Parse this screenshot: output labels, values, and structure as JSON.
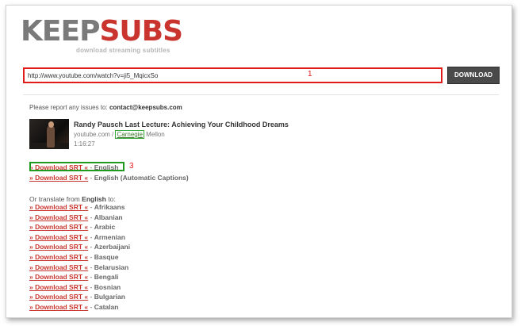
{
  "logo": {
    "keep": "KEEP",
    "subs": "SUBS",
    "tagline": "download streaming subtitles"
  },
  "search": {
    "url_value": "http://www.youtube.com/watch?v=ji5_MqicxSo",
    "download_label": "DOWNLOAD"
  },
  "annotations": {
    "one": "1",
    "three": "3"
  },
  "report": {
    "text": "Please report any issues to:",
    "email": "contact@keepsubs.com"
  },
  "video": {
    "title": "Randy Pausch Last Lecture: Achieving Your Childhood Dreams",
    "source_prefix": "youtube.com / ",
    "source_highlight": "Carnegie",
    "source_suffix": " Mellon",
    "duration": "1:16:27"
  },
  "downloads": [
    {
      "link": "» Download SRT «",
      "sep": " - ",
      "lang": "English"
    },
    {
      "link": "» Download SRT «",
      "sep": " - ",
      "lang": "English (Automatic Captions)"
    }
  ],
  "translate": {
    "prefix": "Or translate from",
    "lang": "English",
    "suffix": "to:"
  },
  "translations": [
    {
      "link": "» Download SRT «",
      "sep": " - ",
      "lang": "Afrikaans"
    },
    {
      "link": "» Download SRT «",
      "sep": " - ",
      "lang": "Albanian"
    },
    {
      "link": "» Download SRT «",
      "sep": " - ",
      "lang": "Arabic"
    },
    {
      "link": "» Download SRT «",
      "sep": " - ",
      "lang": "Armenian"
    },
    {
      "link": "» Download SRT «",
      "sep": " - ",
      "lang": "Azerbaijani"
    },
    {
      "link": "» Download SRT «",
      "sep": " - ",
      "lang": "Basque"
    },
    {
      "link": "» Download SRT «",
      "sep": " - ",
      "lang": "Belarusian"
    },
    {
      "link": "» Download SRT «",
      "sep": " - ",
      "lang": "Bengali"
    },
    {
      "link": "» Download SRT «",
      "sep": " - ",
      "lang": "Bosnian"
    },
    {
      "link": "» Download SRT «",
      "sep": " - ",
      "lang": "Bulgarian"
    },
    {
      "link": "» Download SRT «",
      "sep": " - ",
      "lang": "Catalan"
    }
  ],
  "colors": {
    "brand_red": "#c9352e",
    "annotation_red": "#e21b1b",
    "annotation_green": "#1e9a1e"
  }
}
